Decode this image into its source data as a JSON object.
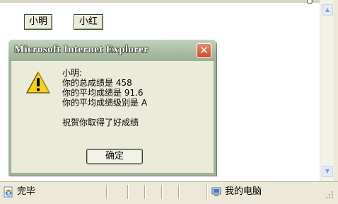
{
  "page": {
    "buttons": [
      {
        "label": "小明"
      },
      {
        "label": "小红"
      }
    ]
  },
  "dialog": {
    "title": "Microsoft Internet Explorer",
    "close_symbol": "✕",
    "message_lines": [
      "小明:",
      "你的总成绩是 458",
      "你的平均成绩是 91.6",
      "你的平均成绩级别是 A",
      "",
      "祝贺你取得了好成绩"
    ],
    "ok_label": "确定",
    "icon": "warning-icon"
  },
  "statusbar": {
    "status_text": "完毕",
    "zone_text": "我的电脑",
    "status_icon": "ie-page-icon",
    "zone_icon": "my-computer-icon"
  },
  "colors": {
    "dialog_frame": "#9eb39a",
    "dialog_body": "#ecead9",
    "close_button": "#cf4a24",
    "warning": "#f2d21a"
  }
}
